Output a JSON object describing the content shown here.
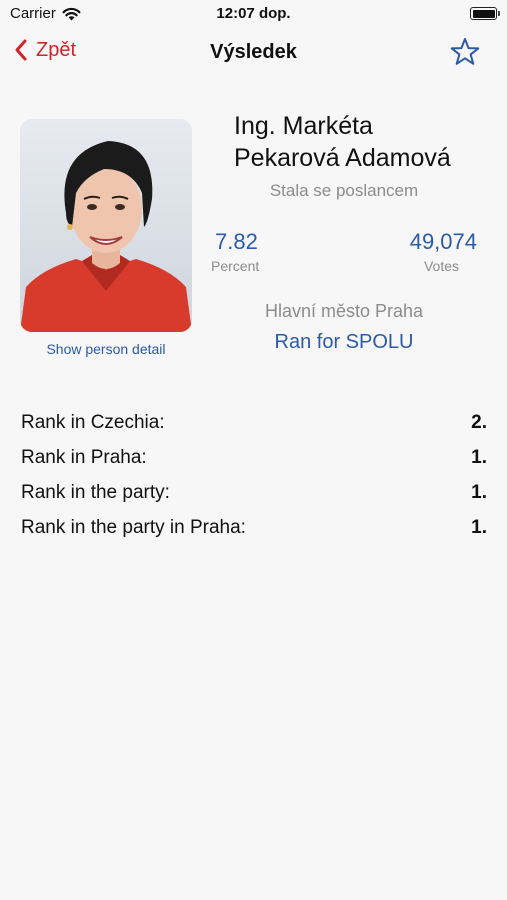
{
  "status_bar": {
    "carrier": "Carrier",
    "time": "12:07 dop."
  },
  "nav": {
    "back_label": "Zpět",
    "title": "Výsledek"
  },
  "person": {
    "name_line1": "Ing. Markéta",
    "name_line2": "Pekarová Adamová",
    "status": "Stala se poslancem",
    "detail_link": "Show person detail"
  },
  "stats": {
    "percent_value": "7.82",
    "percent_label": "Percent",
    "votes_value": "49,074",
    "votes_label": "Votes"
  },
  "region": "Hlavní město Praha",
  "party_link": "Ran for SPOLU",
  "ranks": [
    {
      "label": "Rank in Czechia:",
      "value": "2."
    },
    {
      "label": "Rank in Praha:",
      "value": "1."
    },
    {
      "label": "Rank in the party:",
      "value": "1."
    },
    {
      "label": "Rank in the party in Praha:",
      "value": "1."
    }
  ],
  "colors": {
    "accent_red": "#d0242a",
    "link_blue": "#2b5aa8",
    "secondary_gray": "#8c8c8c"
  },
  "icons": {
    "back": "chevron-left-icon",
    "favorite": "star-icon",
    "wifi": "wifi-icon",
    "battery": "battery-icon"
  }
}
